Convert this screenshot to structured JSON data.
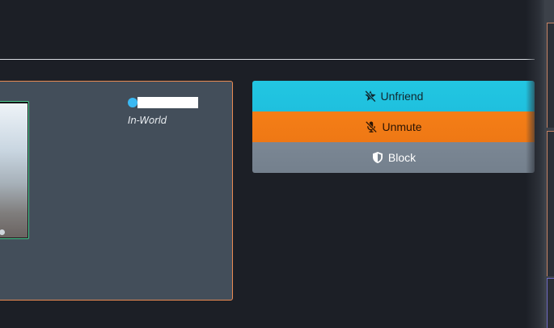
{
  "user_card": {
    "presence": "In-World",
    "status_color": "#3bb9f3",
    "border_color": "#e98a52"
  },
  "actions": {
    "unfriend": {
      "label": "Unfriend",
      "icon": "star-slash-icon",
      "color": "#1fc0de"
    },
    "unmute": {
      "label": "Unmute",
      "icon": "microphone-slash-icon",
      "color": "#f27b16"
    },
    "block": {
      "label": "Block",
      "icon": "shield-icon",
      "color": "#77838f"
    }
  }
}
